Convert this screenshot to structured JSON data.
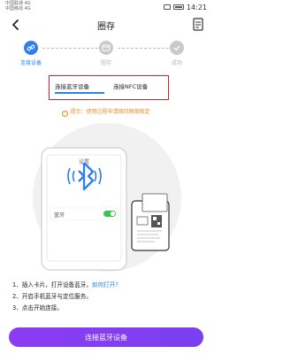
{
  "status_bar": {
    "carrier_line1": "中国联通 4G",
    "carrier_line2": "中国移动 4G",
    "time": "14:21"
  },
  "header": {
    "title": "圈存"
  },
  "stepper": {
    "steps": [
      {
        "label": "连接设备"
      },
      {
        "label": "圈存"
      },
      {
        "label": "成功"
      }
    ],
    "active_color": "#2e7ff0",
    "inactive_color": "#c9c9c9"
  },
  "tabs": [
    {
      "label": "连接蓝牙设备"
    },
    {
      "label": "连接NFC设备"
    }
  ],
  "tip": {
    "text": "提示：使用过程中请保持网络稳定"
  },
  "illustration": {
    "phone_title": "设置",
    "bluetooth_label": "蓝牙"
  },
  "instructions": {
    "step1": "1、插入卡片，打开设备蓝牙。",
    "step1_link": "如何打开?",
    "step2": "2、开启手机蓝牙与定位服务。",
    "step3": "3、点击开始连接。"
  },
  "cta": {
    "label": "连接蓝牙设备"
  },
  "colors": {
    "accent_blue": "#2e7ff0",
    "tip_orange": "#ef8a1f",
    "button_purple": "#8b3cf3",
    "highlight_red": "#e02020"
  }
}
